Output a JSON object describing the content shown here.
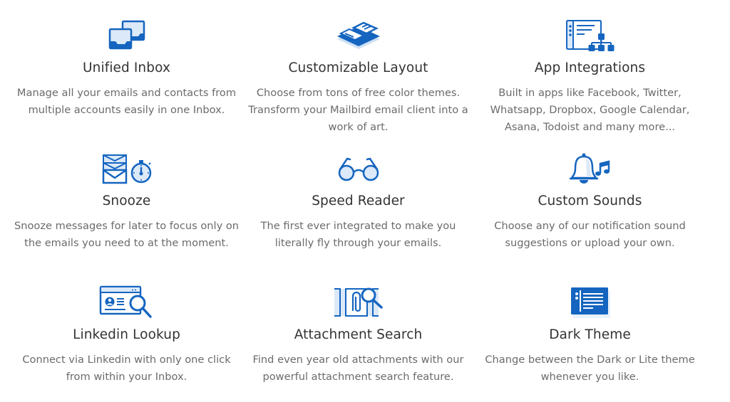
{
  "colors": {
    "icon_primary": "#1565c0",
    "icon_light": "#dce9f8",
    "title": "#333333",
    "description": "#6b6b6b",
    "background": "#ffffff"
  },
  "features": [
    {
      "icon": "unified-inbox-icon",
      "title": "Unified Inbox",
      "description": "Manage all your emails and contacts from multiple accounts easily in one Inbox."
    },
    {
      "icon": "customizable-layout-icon",
      "title": "Customizable Layout",
      "description": "Choose from tons of free color themes. Transform your Mailbird email client into a work of art."
    },
    {
      "icon": "app-integrations-icon",
      "title": "App Integrations",
      "description": "Built in apps like Facebook, Twitter, Whatsapp, Dropbox, Google Calendar, Asana, Todoist and many more..."
    },
    {
      "icon": "snooze-icon",
      "title": "Snooze",
      "description": "Snooze messages for later to focus only on the emails you need to at the moment."
    },
    {
      "icon": "speed-reader-icon",
      "title": "Speed Reader",
      "description": "The first ever integrated to make you literally fly through your emails."
    },
    {
      "icon": "custom-sounds-icon",
      "title": "Custom Sounds",
      "description": "Choose any of our notification sound suggestions or upload your own."
    },
    {
      "icon": "linkedin-lookup-icon",
      "title": "Linkedin Lookup",
      "description": "Connect via Linkedin with only one click from within your Inbox."
    },
    {
      "icon": "attachment-search-icon",
      "title": "Attachment Search",
      "description": "Find even year old attachments with our powerful attachment search feature."
    },
    {
      "icon": "dark-theme-icon",
      "title": "Dark Theme",
      "description": "Change between the Dark or Lite theme whenever you like."
    }
  ]
}
